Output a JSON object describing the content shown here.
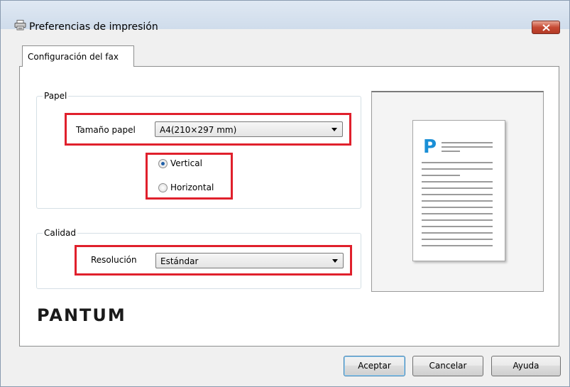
{
  "window": {
    "title": "Preferencias de impresión"
  },
  "tabs": [
    {
      "label": "Configuración del fax"
    }
  ],
  "paper": {
    "group_label": "Papel",
    "size_label": "Tamaño papel",
    "size_value": "A4(210×297 mm)",
    "orientation_options": [
      {
        "label": "Vertical",
        "checked": true
      },
      {
        "label": "Horizontal",
        "checked": false
      }
    ]
  },
  "quality": {
    "group_label": "Calidad",
    "resolution_label": "Resolución",
    "resolution_value": "Estándar"
  },
  "preview": {
    "page_letter": "P"
  },
  "brand": {
    "logo_text": "PANTUM"
  },
  "buttons": {
    "ok": "Aceptar",
    "cancel": "Cancelar",
    "help": "Ayuda"
  },
  "colors": {
    "highlight_box": "#e0202c",
    "accent_blue": "#1a8fd6",
    "close_button": "#c64a34"
  }
}
